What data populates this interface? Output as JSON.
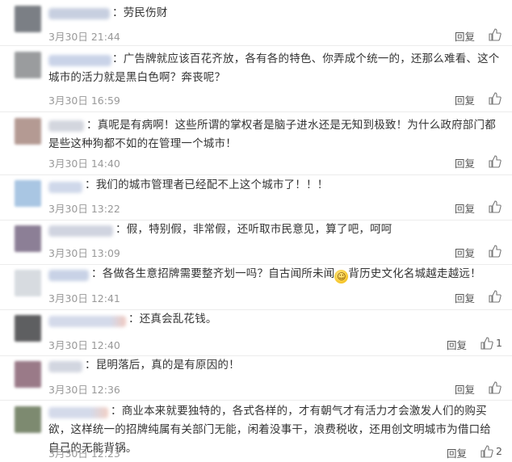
{
  "comments": [
    {
      "text": "：劳民伤财",
      "time": "3月30日 21:44",
      "reply": "回复",
      "likes": "",
      "avatar_color": "#7b7f85",
      "name_color": "#c7cfe0",
      "name_width": 76
    },
    {
      "text": "：广告牌就应该百花齐放，各有各的特色、你弄成个统一的，还那么难看、这个城市的活力就是黑白色啊？奔丧呢？",
      "time": "3月30日 16:59",
      "reply": "回复",
      "likes": "",
      "avatar_color": "#9a9c9e",
      "name_color": "#c9d3e8",
      "name_width": 78
    },
    {
      "text": "：真呢是有病啊！这些所谓的掌权者是脑子进水还是无知到极致！为什么政府部门都是些这种狗都不如的在管理一个城市！",
      "time": "3月30日 14:40",
      "reply": "回复",
      "likes": "",
      "avatar_color": "#b49a93",
      "name_color": "#d3d6de",
      "name_width": 44
    },
    {
      "text": "：我们的城市管理者已经配不上这个城市了！！！",
      "time": "3月30日 13:22",
      "reply": "回复",
      "likes": "",
      "avatar_color": "#a9c6e3",
      "name_color": "#cfd8ea",
      "name_width": 42
    },
    {
      "text": "：假，特别假，非常假，还听取市民意见，算了吧，呵呵",
      "time": "3月30日 13:09",
      "reply": "回复",
      "likes": "",
      "avatar_color": "#8c7f96",
      "name_color": "#d0d4e0",
      "name_width": 80
    },
    {
      "text_a": "：各做各生意招牌需要整齐划一吗？自古闻所未闻",
      "text_b": "背历史文化名城越走越远！",
      "time": "3月30日 12:41",
      "reply": "回复",
      "likes": "",
      "avatar_color": "#d7dbe0",
      "name_color": "#c8d2e6",
      "name_width": 50
    },
    {
      "text": "：还真会乱花钱。",
      "time": "3月30日 12:40",
      "reply": "回复",
      "likes": "1",
      "avatar_color": "#5e5f61",
      "name_color": "#f0c9c0",
      "name_width": 96
    },
    {
      "text": "：昆明落后，真的是有原因的！",
      "time": "3月30日 12:36",
      "reply": "回复",
      "likes": "",
      "avatar_color": "#9a7a88",
      "name_color": "#d2d6e0",
      "name_width": 42
    },
    {
      "text": "：商业本来就要独特的，各式各样的，才有朝气才有活力才会激发人们的购买欲，这样统一的招牌纯属有关部门无能，闲着没事干，浪费税收，还用创文明城市为借口给自己的无能背锅。",
      "time": "3月30日 12:23",
      "reply": "回复",
      "likes": "2",
      "avatar_color": "#7d8a70",
      "name_color": "#f2cfc4",
      "name_width": 74
    }
  ]
}
